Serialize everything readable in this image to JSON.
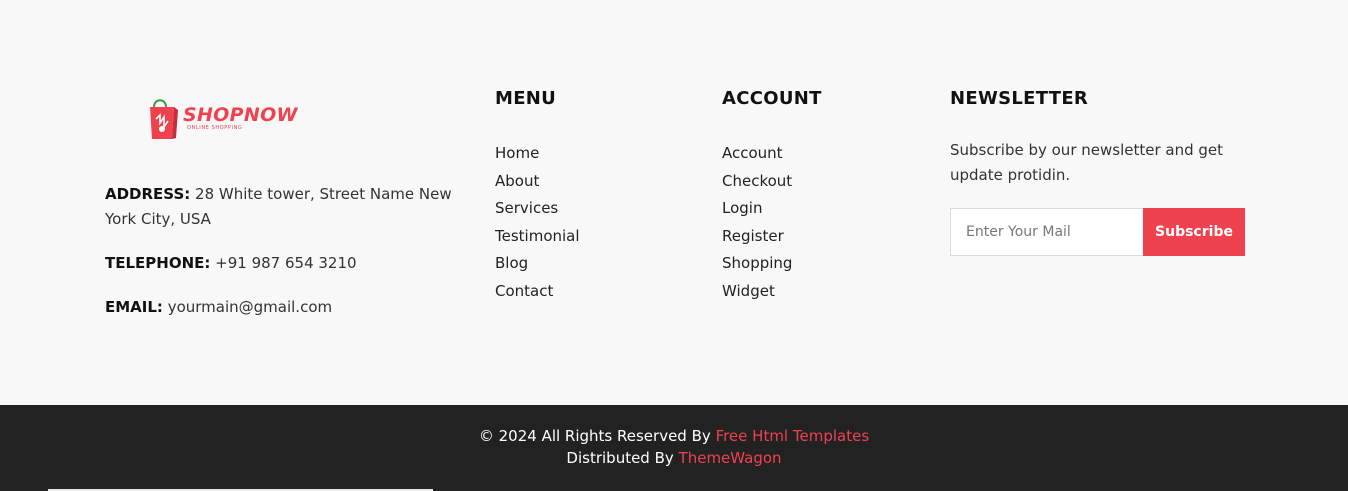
{
  "brand": {
    "logo_name": "SHOPNOW",
    "logo_tagline": "ONLINE SHOPPING",
    "address_label": "ADDRESS:",
    "address_value": "28 White tower, Street Name New York City, USA",
    "phone_label": "TELEPHONE:",
    "phone_value": "+91 987 654 3210",
    "email_label": "EMAIL:",
    "email_value": "yourmain@gmail.com"
  },
  "menu": {
    "title": "MENU",
    "items": [
      "Home",
      "About",
      "Services",
      "Testimonial",
      "Blog",
      "Contact"
    ]
  },
  "account": {
    "title": "ACCOUNT",
    "items": [
      "Account",
      "Checkout",
      "Login",
      "Register",
      "Shopping",
      "Widget"
    ]
  },
  "newsletter": {
    "title": "NEWSLETTER",
    "text": "Subscribe by our newsletter and get update protidin.",
    "placeholder": "Enter Your Mail",
    "button": "Subscribe"
  },
  "copyright": {
    "line1_prefix": "© 2024 All Rights Reserved By",
    "line1_link": "Free Html Templates",
    "line2_prefix": "Distributed By",
    "line2_link": "ThemeWagon"
  },
  "colors": {
    "accent": "#f0414f",
    "bottom_bar": "#222222",
    "background": "#f8f8f8"
  },
  "icons": {
    "logo": "shopping-bag-icon"
  }
}
